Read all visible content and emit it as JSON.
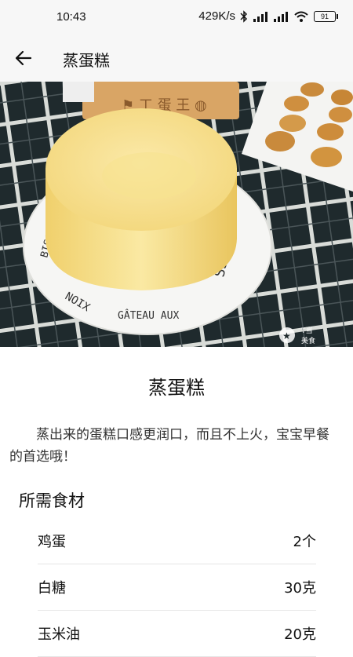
{
  "status_bar": {
    "time": "10:43",
    "net_speed": "429K/s",
    "battery": "91"
  },
  "app_bar": {
    "title": "蒸蛋糕",
    "back_icon": "arrow-left-icon"
  },
  "hero": {
    "plate_text": "BISCUIT DE GÂTEAU AUX NOIX · SSERIE",
    "watermark": "T当 美食"
  },
  "recipe": {
    "title": "蒸蛋糕",
    "description": "蒸出来的蛋糕口感更润口，而且不上火，宝宝早餐的首选哦！"
  },
  "ingredients_section": {
    "title": "所需食材",
    "items": [
      {
        "name": "鸡蛋",
        "amount": "2个"
      },
      {
        "name": "白糖",
        "amount": "30克"
      },
      {
        "name": "玉米油",
        "amount": "20克"
      }
    ]
  }
}
